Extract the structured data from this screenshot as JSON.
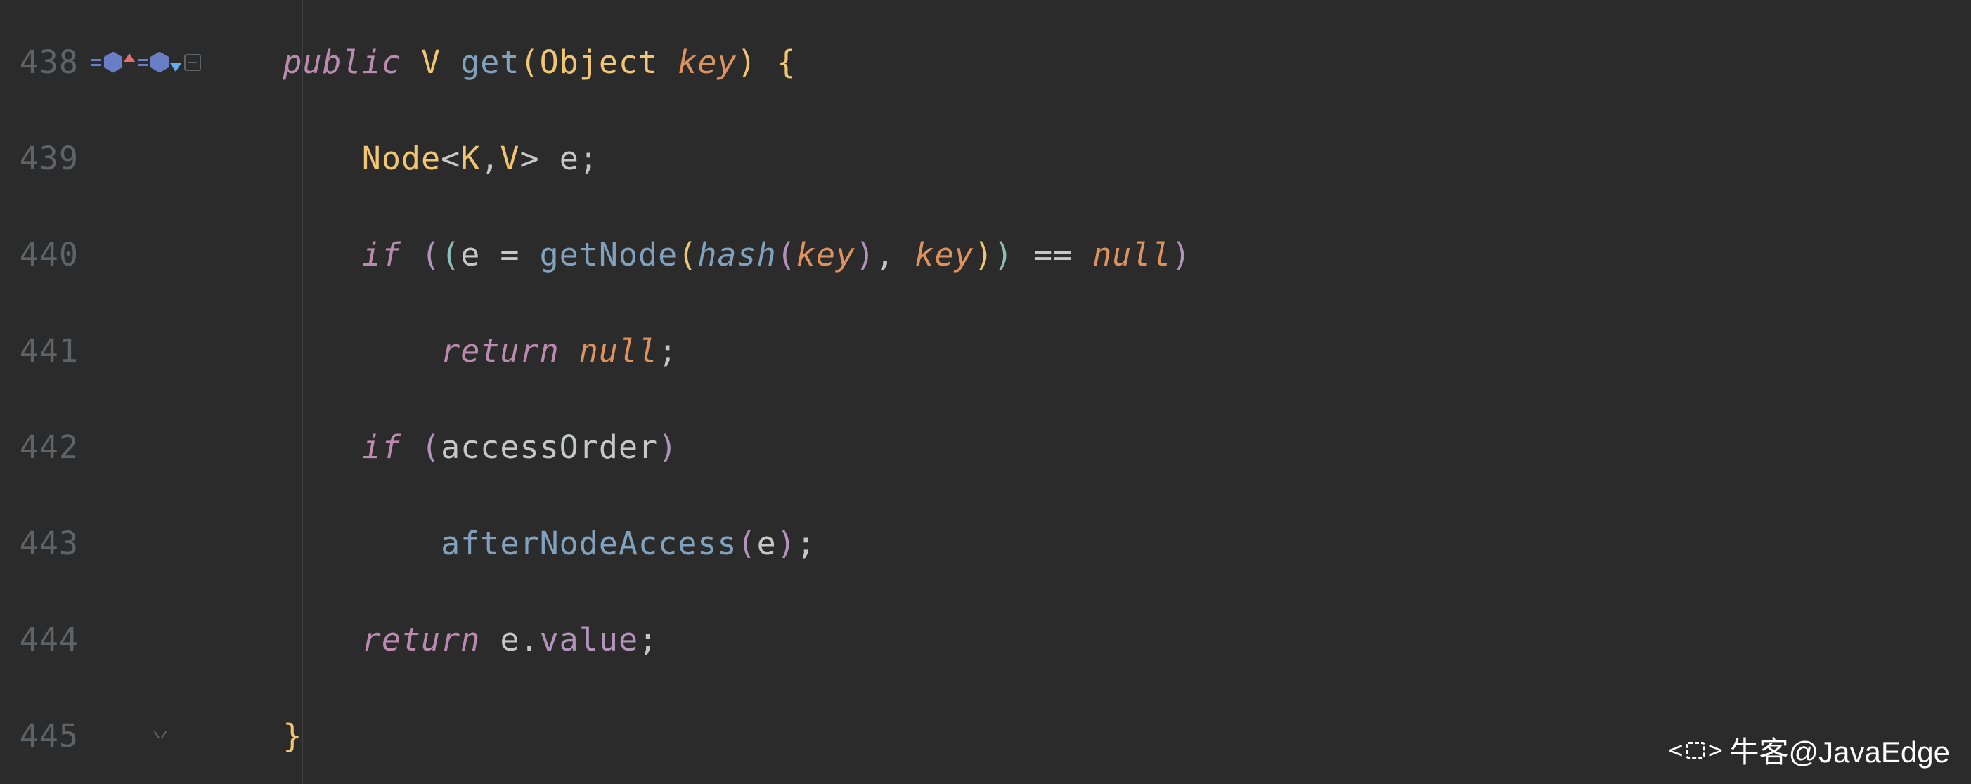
{
  "lines": [
    {
      "num": "438"
    },
    {
      "num": "439"
    },
    {
      "num": "440"
    },
    {
      "num": "441"
    },
    {
      "num": "442"
    },
    {
      "num": "443"
    },
    {
      "num": "444"
    },
    {
      "num": "445"
    }
  ],
  "code": {
    "l0": {
      "indent": "    ",
      "kw_public": "public",
      "sp1": " ",
      "type_v": "V",
      "sp2": " ",
      "method": "get",
      "paren_o": "(",
      "ptype": "Object",
      "sp3": " ",
      "param": "key",
      "paren_c": ")",
      "sp4": " ",
      "brace_o": "{"
    },
    "l1": {
      "indent": "        ",
      "type": "Node",
      "lt": "<",
      "k": "K",
      "comma": ",",
      "v": "V",
      "gt": ">",
      "sp": " ",
      "var": "e",
      "semi": ";"
    },
    "l2": {
      "indent": "        ",
      "kw_if": "if",
      "sp1": " ",
      "p1o": "(",
      "p2o": "(",
      "var_e": "e",
      "sp2": " ",
      "eq": "=",
      "sp3": " ",
      "m_getnode": "getNode",
      "p3o": "(",
      "m_hash": "hash",
      "p4o": "(",
      "key1": "key",
      "p4c": ")",
      "comma": ",",
      "sp4": " ",
      "key2": "key",
      "p3c": ")",
      "p2c": ")",
      "sp5": " ",
      "eqeq": "==",
      "sp6": " ",
      "null": "null",
      "p1c": ")"
    },
    "l3": {
      "indent": "            ",
      "kw_return": "return",
      "sp": " ",
      "null": "null",
      "semi": ";"
    },
    "l4": {
      "indent": "        ",
      "kw_if": "if",
      "sp": " ",
      "po": "(",
      "var": "accessOrder",
      "pc": ")"
    },
    "l5": {
      "indent": "            ",
      "method": "afterNodeAccess",
      "po": "(",
      "arg": "e",
      "pc": ")",
      "semi": ";"
    },
    "l6": {
      "indent": "        ",
      "kw_return": "return",
      "sp": " ",
      "var": "e",
      "dot": ".",
      "field": "value",
      "semi": ";"
    },
    "l7": {
      "indent": "    ",
      "brace_c": "}"
    }
  },
  "watermark": {
    "text": "牛客@JavaEdge"
  }
}
